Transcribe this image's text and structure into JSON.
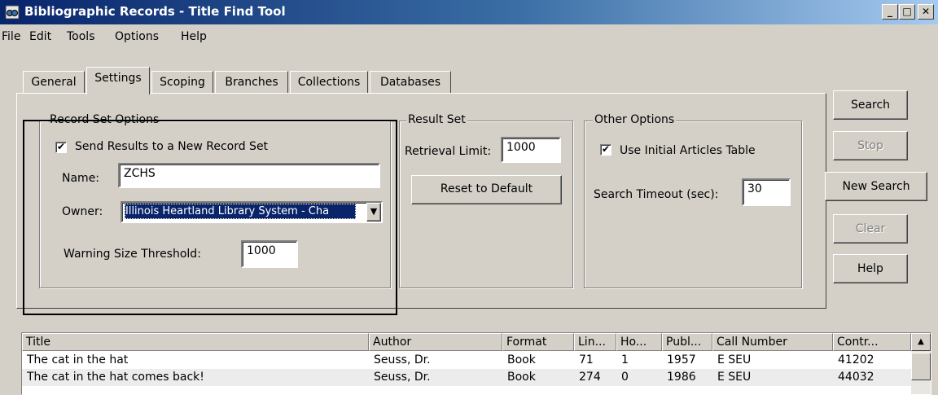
{
  "window": {
    "title": "Bibliographic Records - Title Find Tool",
    "app_icon": "binoculars-search-icon",
    "minimize": "_",
    "maximize": "□",
    "close": "✕"
  },
  "menu": [
    "File",
    "Edit",
    "Tools",
    "Options",
    "Help"
  ],
  "tabs": [
    "General",
    "Settings",
    "Scoping",
    "Branches",
    "Collections",
    "Databases"
  ],
  "active_tab": "Settings",
  "record_set_options": {
    "legend": "Record Set Options",
    "send_results_label": "Send Results to a New Record Set",
    "send_results_checked": "✔",
    "name_label": "Name:",
    "name_value": "ZCHS",
    "owner_label": "Owner:",
    "owner_value": "Illinois Heartland Library System - Cha",
    "dropdown_arrow": "▼",
    "warning_label": "Warning Size Threshold:",
    "warning_value": "1000"
  },
  "result_set": {
    "legend": "Result Set",
    "retrieval_label": "Retrieval Limit:",
    "retrieval_value": "1000",
    "reset_button": "Reset to Default"
  },
  "other_options": {
    "legend": "Other Options",
    "initial_articles_label": "Use Initial Articles Table",
    "initial_articles_checked": "✔",
    "timeout_label": "Search Timeout (sec):",
    "timeout_value": "30"
  },
  "side_buttons": {
    "search": "Search",
    "stop": "Stop",
    "new_search": "New Search",
    "clear": "Clear",
    "help": "Help"
  },
  "results": {
    "columns": [
      "Title",
      "Author",
      "Format",
      "Lin...",
      "Ho...",
      "Publ...",
      "Call Number",
      "Contr..."
    ],
    "rows": [
      [
        "The cat in the hat",
        "Seuss, Dr.",
        "Book",
        "71",
        "1",
        "1957",
        "E SEU",
        "41202"
      ],
      [
        "The cat in the hat comes back!",
        "Seuss, Dr.",
        "Book",
        "274",
        "0",
        "1986",
        "E SEU",
        "44032"
      ]
    ],
    "scroll_up": "▲"
  },
  "colors": {
    "title_bar": "#08246b",
    "face": "#d4d0c8",
    "selection": "#0a246a"
  }
}
